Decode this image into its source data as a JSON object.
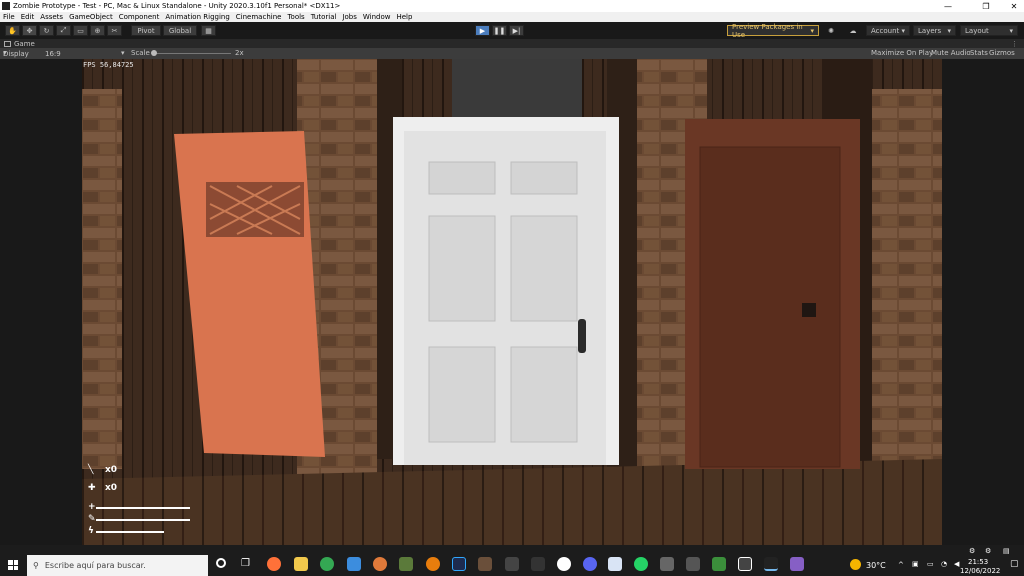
{
  "window": {
    "title": "Zombie Prototype - Test - PC, Mac & Linux Standalone - Unity 2020.3.10f1 Personal* <DX11>",
    "minimize": "—",
    "maximize": "❐",
    "close": "✕"
  },
  "menu": [
    "File",
    "Edit",
    "Assets",
    "GameObject",
    "Component",
    "Animation Rigging",
    "Cinemachine",
    "Tools",
    "Tutorial",
    "Jobs",
    "Window",
    "Help"
  ],
  "toolbar": {
    "pivot": "Pivot",
    "global": "Global",
    "preview_packages": "Preview Packages in Use",
    "account": "Account",
    "layers": "Layers",
    "layout": "Layout"
  },
  "game_view": {
    "tab": "Game",
    "display": "Display 1",
    "aspect": "16:9 Aspect",
    "scale_label": "Scale",
    "scale_value": "2x",
    "maximize_on_play": "Maximize On Play",
    "mute_audio": "Mute Audio",
    "stats": "Stats",
    "gizmos": "Gizmos"
  },
  "hud": {
    "fps_label": "FPS",
    "fps_value": "56,84725",
    "weapon_count": "x0",
    "medkit_count": "x0",
    "health_fill": 1.0,
    "stamina_fill": 1.0,
    "energy_fill": 0.72
  },
  "taskbar": {
    "search_placeholder": "Escribe aquí para buscar.",
    "weather": "30°C",
    "time": "21:53",
    "date": "12/06/2022"
  }
}
